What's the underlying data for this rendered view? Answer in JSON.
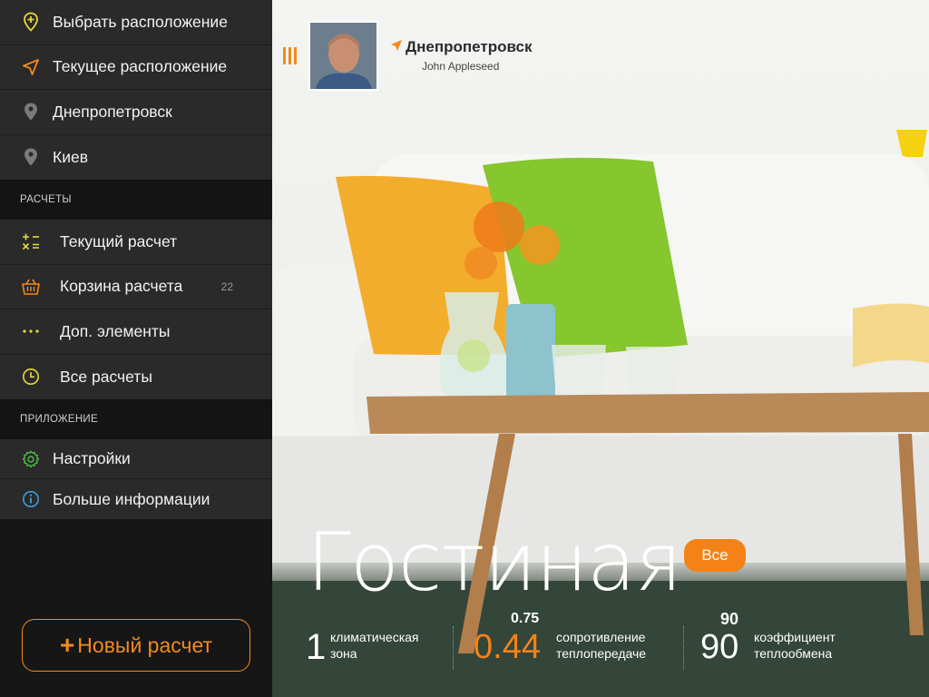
{
  "sidebar": {
    "locations": [
      {
        "label": "Выбрать расположение",
        "icon": "pin-plus-icon"
      },
      {
        "label": "Текущее расположение",
        "icon": "navigation-arrow-icon"
      },
      {
        "label": "Днепропетровск",
        "icon": "map-pin-icon"
      },
      {
        "label": "Киев",
        "icon": "map-pin-icon"
      }
    ],
    "calculations_header": "РАСЧЕТЫ",
    "calculations": [
      {
        "label": "Текущий расчет",
        "icon": "calculator-icon",
        "count": ""
      },
      {
        "label": "Корзина расчета",
        "icon": "basket-icon",
        "count": "22"
      },
      {
        "label": "Доп. элементы",
        "icon": "more-dots-icon",
        "count": ""
      },
      {
        "label": "Все расчеты",
        "icon": "clock-icon",
        "count": ""
      }
    ],
    "app_header": "ПРИЛОЖЕНИЕ",
    "app_items": [
      {
        "label": "Настройки",
        "icon": "gear-icon"
      },
      {
        "label": "Больше информации",
        "icon": "info-icon"
      }
    ],
    "new_button_plus": "+",
    "new_button_label": "Новый расчет"
  },
  "header": {
    "location": "Днепропетровск",
    "user": "John Appleseed"
  },
  "room": {
    "title": "Гостиная",
    "badge": "Все"
  },
  "stats": [
    {
      "top": "",
      "value": "1",
      "label_line1": "климатическая",
      "label_line2": "зона"
    },
    {
      "top": "0.75",
      "value": "0.44",
      "label_line1": "сопротивление",
      "label_line2": "теплопередаче"
    },
    {
      "top": "90",
      "value": "90",
      "label_line1": "коэффициент",
      "label_line2": "теплообмена"
    }
  ],
  "colors": {
    "accent": "#f58216",
    "sidebar_bg": "#161616",
    "menu_bg": "#2a2a2a"
  }
}
